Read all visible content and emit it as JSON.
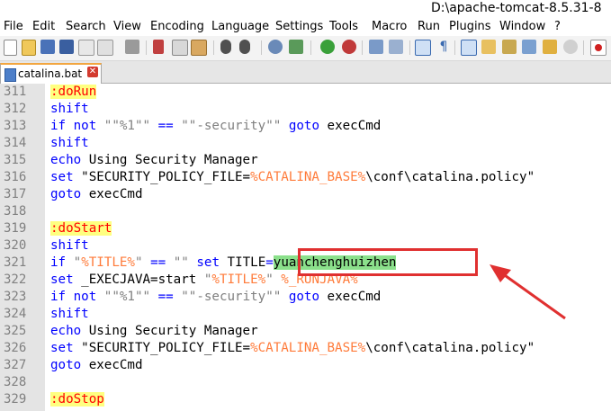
{
  "window": {
    "title": "D:\\apache-tomcat-8.5.31-8"
  },
  "menu": [
    "File",
    "Edit",
    "Search",
    "View",
    "Encoding",
    "Language",
    "Settings",
    "Tools",
    "Macro",
    "Run",
    "Plugins",
    "Window",
    "?"
  ],
  "tab": {
    "label": "catalina.bat",
    "close": "✕"
  },
  "lines": [
    {
      "n": "311",
      "parts": [
        [
          "lbl",
          ":doRun"
        ]
      ]
    },
    {
      "n": "312",
      "parts": [
        [
          "kw",
          "shift"
        ]
      ]
    },
    {
      "n": "313",
      "parts": [
        [
          "kw",
          "if not"
        ],
        [
          "",
          " "
        ],
        [
          "str",
          "\"\"%1\"\""
        ],
        [
          "",
          " "
        ],
        [
          "kw",
          "=="
        ],
        [
          "",
          " "
        ],
        [
          "str",
          "\"\"-security\"\""
        ],
        [
          "",
          " "
        ],
        [
          "kw",
          "goto"
        ],
        [
          "",
          " execCmd"
        ]
      ]
    },
    {
      "n": "314",
      "parts": [
        [
          "kw",
          "shift"
        ]
      ]
    },
    {
      "n": "315",
      "parts": [
        [
          "kw",
          "echo"
        ],
        [
          "",
          " Using Security Manager"
        ]
      ]
    },
    {
      "n": "316",
      "parts": [
        [
          "kw",
          "set"
        ],
        [
          "",
          " \"SECURITY_POLICY_FILE="
        ],
        [
          "var",
          "%CATALINA_BASE%"
        ],
        [
          "",
          "\\conf\\catalina.policy\""
        ]
      ]
    },
    {
      "n": "317",
      "parts": [
        [
          "kw",
          "goto"
        ],
        [
          "",
          " execCmd"
        ]
      ]
    },
    {
      "n": "318",
      "parts": []
    },
    {
      "n": "319",
      "parts": [
        [
          "lbl",
          ":doStart"
        ]
      ]
    },
    {
      "n": "320",
      "parts": [
        [
          "kw",
          "shift"
        ]
      ]
    },
    {
      "n": "321",
      "parts": [
        [
          "kw",
          "if"
        ],
        [
          "",
          " "
        ],
        [
          "str",
          "\""
        ],
        [
          "var",
          "%TITLE%"
        ],
        [
          "str",
          "\""
        ],
        [
          "",
          " "
        ],
        [
          "kw",
          "=="
        ],
        [
          "",
          " "
        ],
        [
          "str",
          "\"\""
        ],
        [
          "",
          " "
        ],
        [
          "kw",
          "set"
        ],
        [
          "",
          " TITLE"
        ],
        [
          "kw",
          "="
        ],
        [
          "hl",
          "yuanchenghuizhen"
        ]
      ]
    },
    {
      "n": "322",
      "parts": [
        [
          "kw",
          "set"
        ],
        [
          "",
          " _EXECJAVA=start "
        ],
        [
          "str",
          "\""
        ],
        [
          "var",
          "%TITLE%"
        ],
        [
          "str",
          "\""
        ],
        [
          "",
          " "
        ],
        [
          "var",
          "%_RUNJAVA%"
        ]
      ]
    },
    {
      "n": "323",
      "parts": [
        [
          "kw",
          "if not"
        ],
        [
          "",
          " "
        ],
        [
          "str",
          "\"\"%1\"\""
        ],
        [
          "",
          " "
        ],
        [
          "kw",
          "=="
        ],
        [
          "",
          " "
        ],
        [
          "str",
          "\"\"-security\"\""
        ],
        [
          "",
          " "
        ],
        [
          "kw",
          "goto"
        ],
        [
          "",
          " execCmd"
        ]
      ]
    },
    {
      "n": "324",
      "parts": [
        [
          "kw",
          "shift"
        ]
      ]
    },
    {
      "n": "325",
      "parts": [
        [
          "kw",
          "echo"
        ],
        [
          "",
          " Using Security Manager"
        ]
      ]
    },
    {
      "n": "326",
      "parts": [
        [
          "kw",
          "set"
        ],
        [
          "",
          " \"SECURITY_POLICY_FILE="
        ],
        [
          "var",
          "%CATALINA_BASE%"
        ],
        [
          "",
          "\\conf\\catalina.policy\""
        ]
      ]
    },
    {
      "n": "327",
      "parts": [
        [
          "kw",
          "goto"
        ],
        [
          "",
          " execCmd"
        ]
      ]
    },
    {
      "n": "328",
      "parts": []
    },
    {
      "n": "329",
      "parts": [
        [
          "lbl",
          ":doStop"
        ]
      ]
    }
  ],
  "colors": {
    "keyword": "#0000ff",
    "variable": "#ff7b3a",
    "label": "#ff0000",
    "label_bg": "#ffff80",
    "selection": "#8be08b",
    "annotation": "#e03030"
  },
  "toolbar_icons": [
    "new-file-icon",
    "open-file-icon",
    "save-icon",
    "save-all-icon",
    "close-icon",
    "close-all-icon",
    "print-icon",
    "cut-icon",
    "copy-icon",
    "paste-icon",
    "undo-icon",
    "redo-icon",
    "find-icon",
    "replace-icon",
    "zoom-in-icon",
    "zoom-out-icon",
    "sync-vertical-icon",
    "sync-horizontal-icon",
    "word-wrap-icon",
    "show-all-chars-icon",
    "indent-guide-icon",
    "user-language-icon",
    "doc-map-icon",
    "function-list-icon",
    "folder-workspace-icon",
    "monitoring-icon",
    "record-macro-icon"
  ]
}
